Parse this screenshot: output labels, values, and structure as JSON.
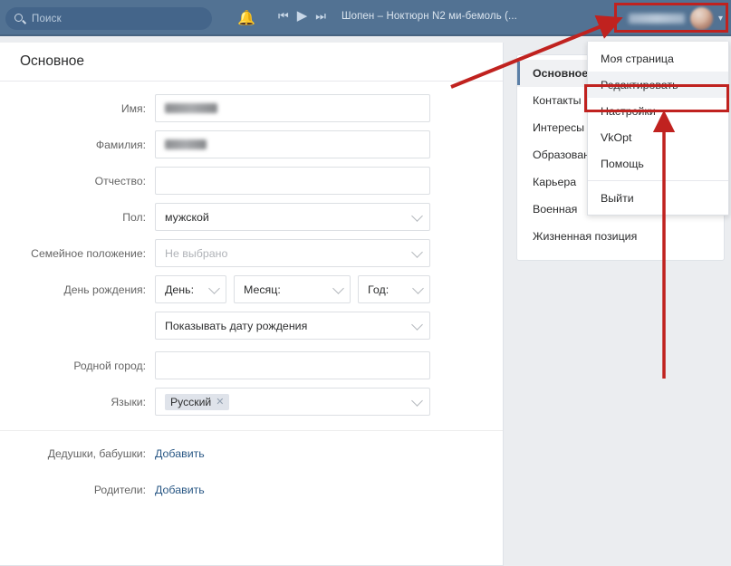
{
  "topbar": {
    "search": {
      "placeholder": "Поиск",
      "icon": "search-icon"
    },
    "bell_icon": "bell-icon",
    "player": {
      "prev_icon": "skip-previous-icon",
      "play_icon": "play-icon",
      "next_icon": "skip-next-icon",
      "track": "Шопен – Ноктюрн N2 ми-бемоль (..."
    },
    "user": {
      "name": "",
      "avatar_icon": "avatar",
      "chevron_icon": "chevron-down-icon"
    }
  },
  "menu": {
    "items": [
      {
        "label": "Моя страница",
        "selected": false
      },
      {
        "label": "Редактировать",
        "selected": true
      },
      {
        "label": "Настройки",
        "selected": false
      },
      {
        "label": "VkOpt",
        "selected": false
      },
      {
        "label": "Помощь",
        "selected": false
      },
      {
        "label": "Выйти",
        "selected": false
      }
    ]
  },
  "nav": {
    "items": [
      "Основное",
      "Контакты",
      "Интересы",
      "Образование",
      "Карьера",
      "Военная",
      "Жизненная позиция"
    ],
    "active_index": 0
  },
  "main": {
    "title": "Основное",
    "fields": {
      "first_name": {
        "label": "Имя:",
        "value": "",
        "redacted": true
      },
      "last_name": {
        "label": "Фамилия:",
        "value": "",
        "redacted": true
      },
      "middle_name": {
        "label": "Отчество:",
        "value": ""
      },
      "gender": {
        "label": "Пол:",
        "value": "мужской",
        "is_placeholder": false
      },
      "marital": {
        "label": "Семейное положение:",
        "value": "Не выбрано",
        "is_placeholder": true
      },
      "birthday": {
        "label": "День рождения:",
        "day": "День:",
        "month": "Месяц:",
        "year": "Год:",
        "visibility": "Показывать дату рождения"
      },
      "home_town": {
        "label": "Родной город:",
        "value": ""
      },
      "languages": {
        "label": "Языки:",
        "chip": "Русский",
        "chip_remove_icon": "✕"
      },
      "grandparents": {
        "label": "Дедушки, бабушки:",
        "action": "Добавить"
      },
      "parents": {
        "label": "Родители:",
        "action": "Добавить"
      }
    }
  },
  "annotations": {
    "highlight_color": "#c0221f",
    "arrow_to_user": "arrow-pointing-to-user-menu",
    "arrow_to_edit": "arrow-pointing-to-edit-item"
  },
  "colors": {
    "header": "#527293",
    "page_bg": "#ebedf0",
    "card_bg": "#ffffff",
    "link": "#2a5885",
    "accent_red": "#c0221f"
  }
}
